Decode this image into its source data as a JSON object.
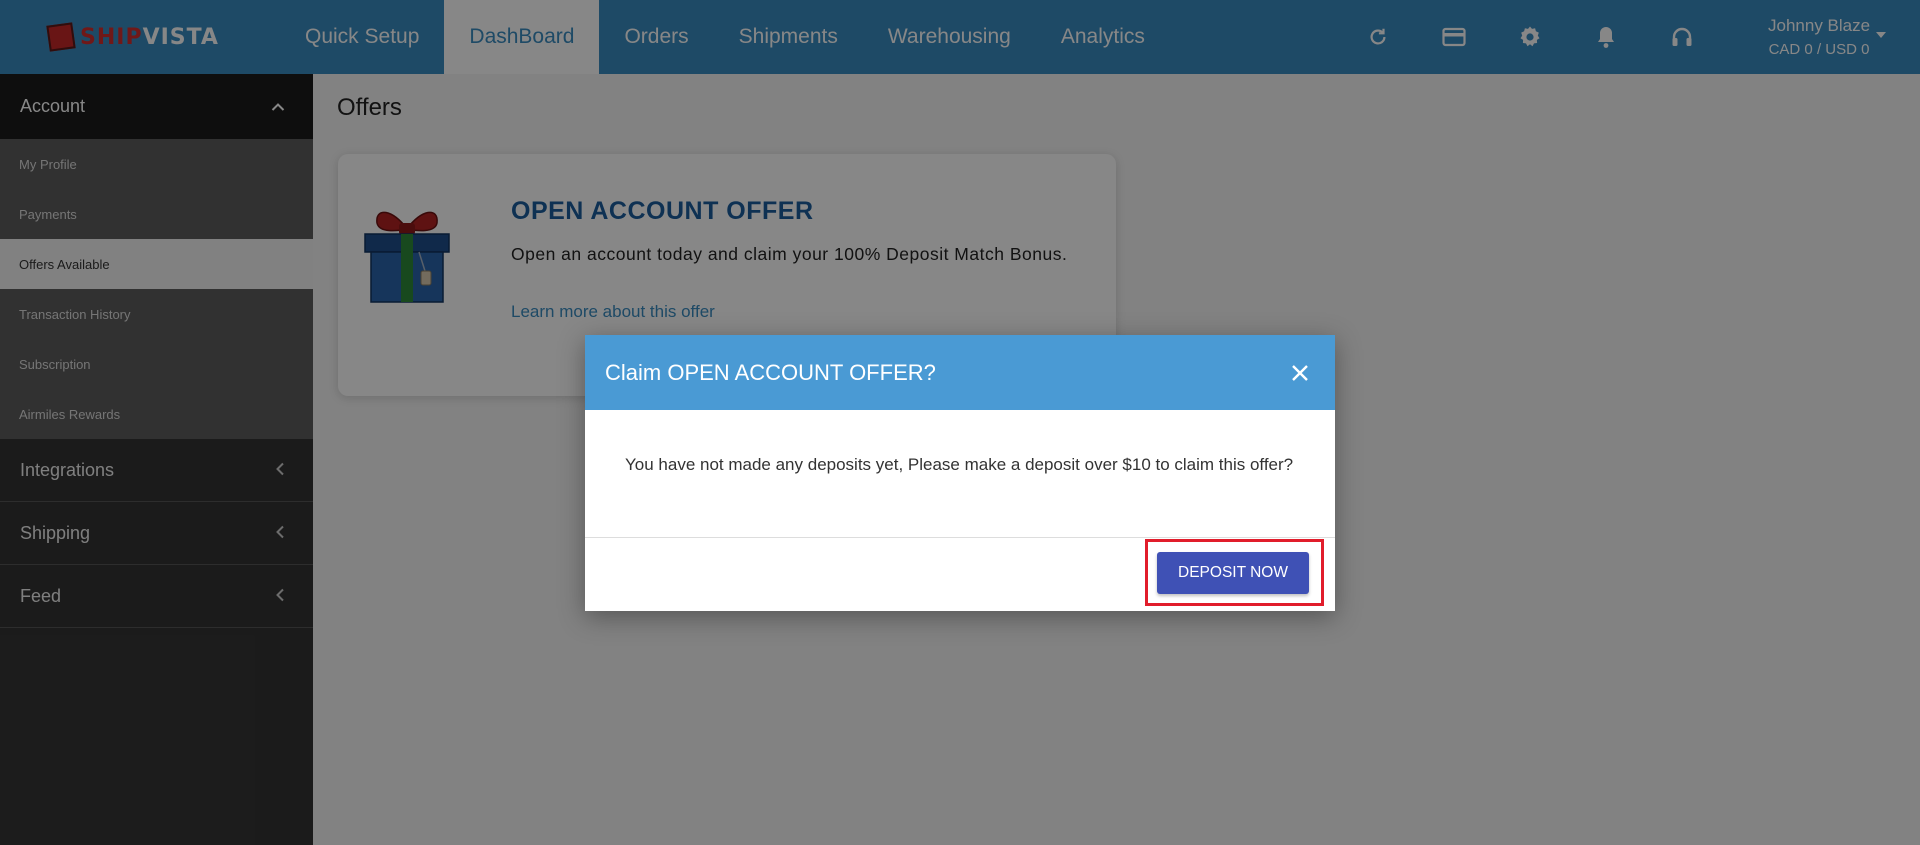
{
  "brand": {
    "ship": "SHIP",
    "vista": "VISTA"
  },
  "nav": {
    "tabs": [
      {
        "label": "Quick Setup",
        "active": false
      },
      {
        "label": "DashBoard",
        "active": true
      },
      {
        "label": "Orders",
        "active": false
      },
      {
        "label": "Shipments",
        "active": false
      },
      {
        "label": "Warehousing",
        "active": false
      },
      {
        "label": "Analytics",
        "active": false
      }
    ],
    "icons": [
      "refresh-icon",
      "credit-card-icon",
      "gear-icon",
      "bell-icon",
      "headset-icon"
    ]
  },
  "user": {
    "name": "Johnny Blaze",
    "balance": "CAD 0 / USD 0"
  },
  "sidebar": {
    "account_label": "Account",
    "account_items": [
      {
        "label": "My Profile",
        "active": false
      },
      {
        "label": "Payments",
        "active": false
      },
      {
        "label": "Offers Available",
        "active": true
      },
      {
        "label": "Transaction History",
        "active": false
      },
      {
        "label": "Subscription",
        "active": false
      },
      {
        "label": "Airmiles Rewards",
        "active": false
      }
    ],
    "sections": [
      {
        "label": "Integrations"
      },
      {
        "label": "Shipping"
      },
      {
        "label": "Feed"
      }
    ]
  },
  "main": {
    "page_title": "Offers",
    "offer": {
      "title": "OPEN ACCOUNT OFFER",
      "description": "Open an account today and claim your 100% Deposit Match Bonus.",
      "link": "Learn more about this offer"
    }
  },
  "modal": {
    "title": "Claim OPEN ACCOUNT OFFER?",
    "body": "You have not made any deposits yet, Please make a deposit over $10 to claim this offer?",
    "button": "DEPOSIT NOW"
  },
  "colors": {
    "topbar": "#3a8cc1",
    "modal_header": "#4a9ad4",
    "button": "#3f51b5",
    "highlight": "#e11d2b",
    "offer_title": "#1b5e9e"
  }
}
